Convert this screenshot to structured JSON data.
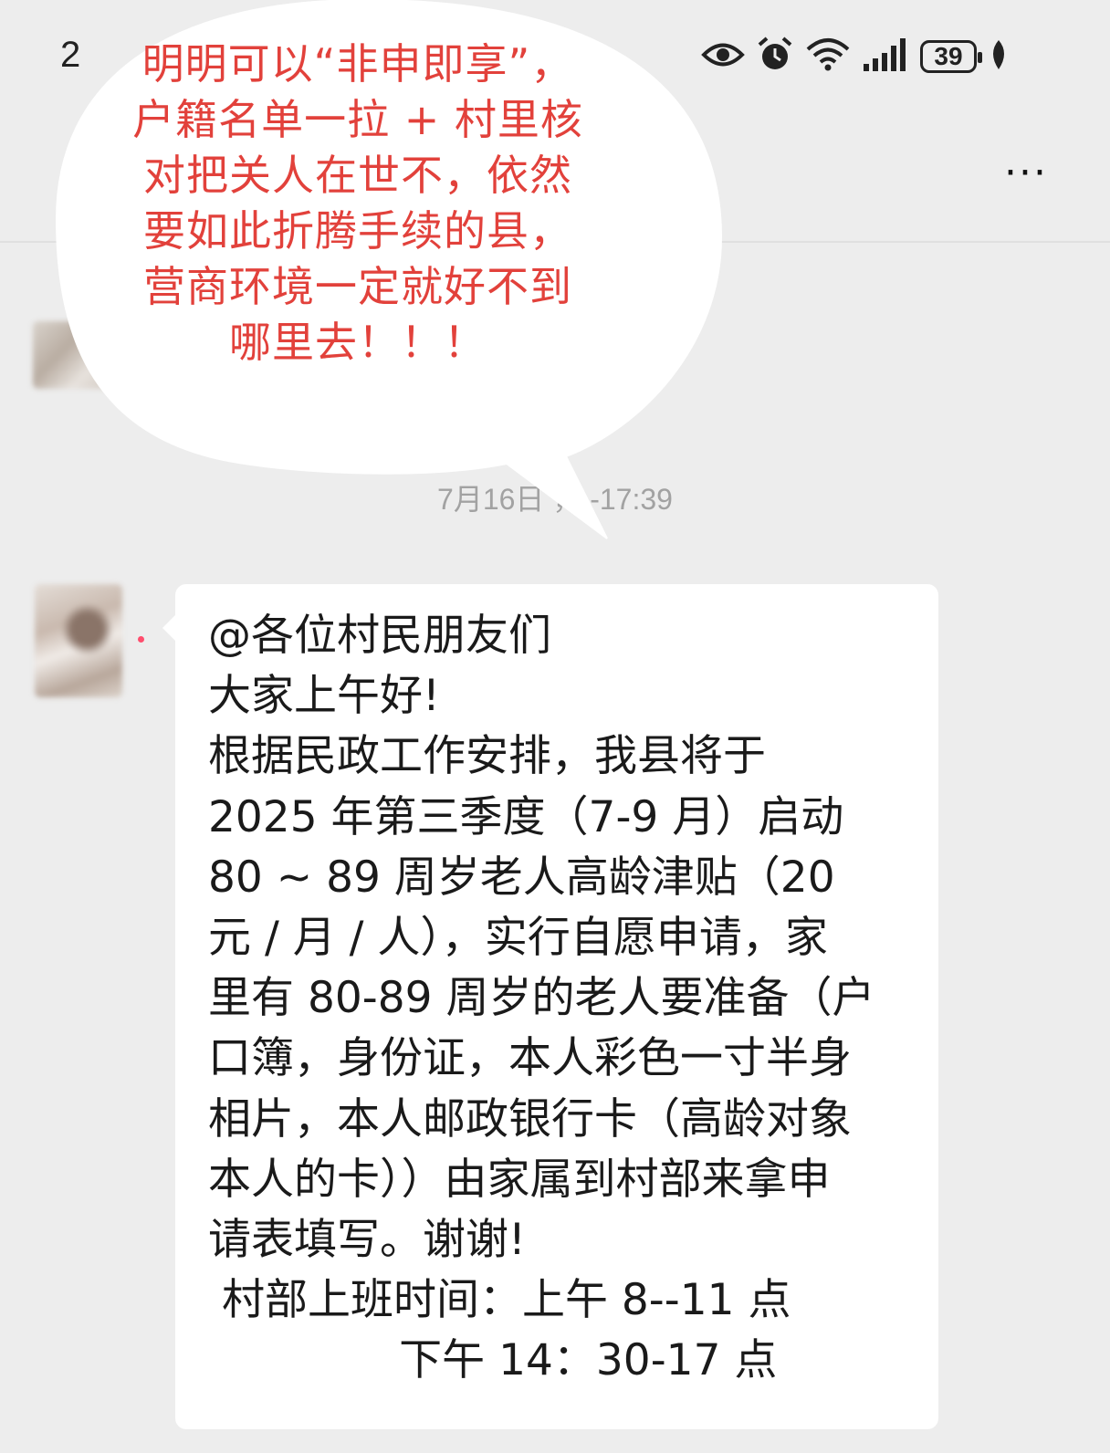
{
  "status_bar": {
    "time_partial": "2",
    "battery": "39",
    "icons": [
      "eye-icon",
      "alarm-icon",
      "wifi-icon",
      "signal-icon",
      "battery-icon",
      "leaf-icon"
    ]
  },
  "header": {
    "more_label": "···"
  },
  "chat": {
    "timestamp": "7月16日 ， -17:39",
    "message": {
      "lines": [
        "@各位村民朋友们",
        "大家上午好!",
        "根据民政工作安排，我县将于",
        "2025 年第三季度（7-9 月）启动",
        "80 ~ 89 周岁老人高龄津贴（20",
        "元 / 月 / 人），实行自愿申请，家",
        "里有 80-89 周岁的老人要准备（户",
        "口簿，身份证，本人彩色一寸半身",
        "相片，本人邮政银行卡（高龄对象",
        "本人的卡））由家属到村部来拿申",
        "请表填写。谢谢!",
        " 村部上班时间：上午 8--11 点",
        "              下午 14：30-17 点"
      ]
    }
  },
  "annotation": {
    "text": "明明可以“非申即享”，\n户籍名单一拉 + 村里核\n对把关人在世不，依然\n要如此折腾手续的县，\n营商环境一定就好不到\n哪里去！！！",
    "color": "#e2413b"
  },
  "colors": {
    "background": "#ededed",
    "bubble": "#ffffff",
    "timestamp": "#a2a2a2"
  }
}
